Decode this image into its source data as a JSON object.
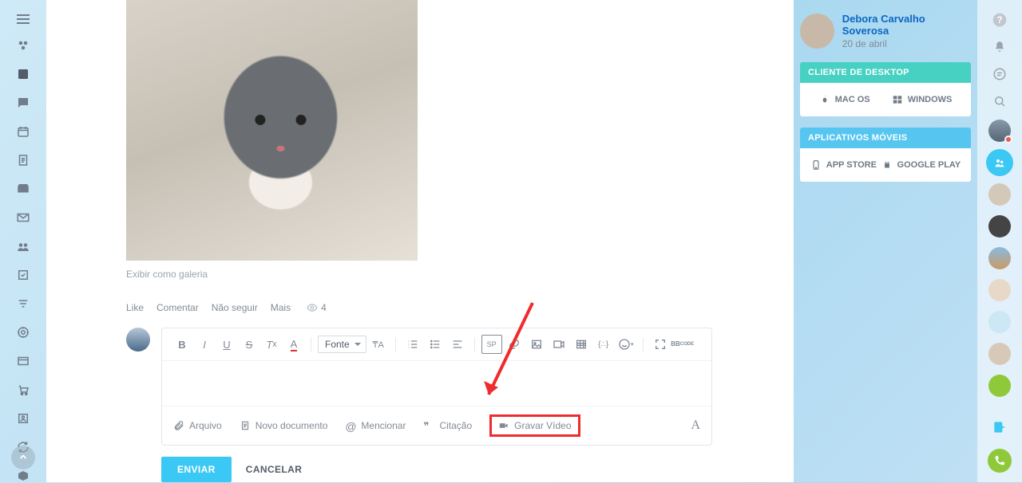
{
  "left_nav": {
    "menu": "menu",
    "items": [
      "logo",
      "stream",
      "chat",
      "calendar",
      "doc",
      "drive",
      "mail",
      "workgroups",
      "tasks",
      "filter",
      "crm",
      "marketplace",
      "cart",
      "contacts",
      "refresh",
      "box"
    ]
  },
  "post": {
    "gallery_link": "Exibir como galeria",
    "actions": {
      "like": "Like",
      "comment": "Comentar",
      "unfollow": "Não seguir",
      "more": "Mais",
      "views": "4"
    }
  },
  "editor": {
    "font_label": "Fonte",
    "attach": {
      "file": "Arquivo",
      "new_doc": "Novo documento",
      "mention": "Mencionar",
      "quote": "Citação",
      "record": "Gravar Vídeo"
    }
  },
  "submit": {
    "send": "ENVIAR",
    "cancel": "CANCELAR"
  },
  "user": {
    "name": "Debora Carvalho Soverosa",
    "date": "20 de abril"
  },
  "panels": {
    "desktop": {
      "title": "CLIENTE DE DESKTOP",
      "mac": "MAC OS",
      "win": "WINDOWS"
    },
    "mobile": {
      "title": "APLICATIVOS MÓVEIS",
      "ios": "APP STORE",
      "android": "GOOGLE PLAY"
    }
  },
  "bbcode": "BB"
}
